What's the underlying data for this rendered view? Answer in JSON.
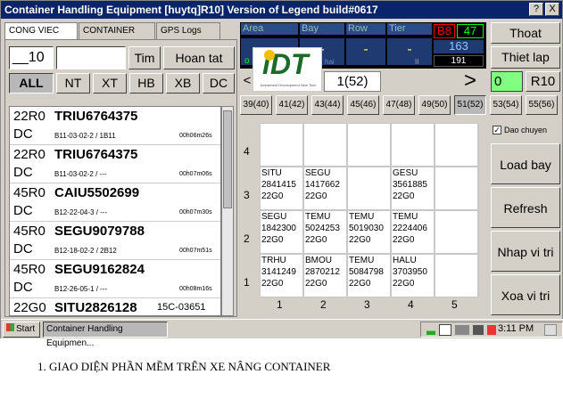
{
  "window": {
    "title": "Container Handling Equipment [huytq]R10] Version of Legend build#0617",
    "help": "?",
    "close": "X"
  },
  "tabs": [
    "CONG VIEC",
    "CONTAINER",
    "GPS Logs"
  ],
  "job_input": {
    "value": "__10",
    "value2": ""
  },
  "buttons": {
    "tim": "Tim",
    "hoan_tat": "Hoan tat"
  },
  "filters": [
    "ALL",
    "NT",
    "XT",
    "HB",
    "XB",
    "DC"
  ],
  "jobs": [
    {
      "size": "22R0",
      "container": "TRIU6764375",
      "type": "DC",
      "loc": "B11-03-02-2 / 1B11",
      "time": "00h06m26s"
    },
    {
      "size": "22R0",
      "container": "TRIU6764375",
      "type": "DC",
      "loc": "B11-03-02-2 / ---",
      "time": "00h07m06s"
    },
    {
      "size": "45R0",
      "container": "CAIU5502699",
      "type": "DC",
      "loc": "B12-22-04-3 / ---",
      "time": "00h07m30s"
    },
    {
      "size": "45R0",
      "container": "SEGU9079788",
      "type": "DC",
      "loc": "B12-18-02-2 / 2B12",
      "time": "00h07m51s"
    },
    {
      "size": "45R0",
      "container": "SEGU9162824",
      "type": "DC",
      "loc": "B12-26-05-1 / ---",
      "time": "00h08m16s"
    },
    {
      "size": "22G0",
      "container": "SITU2826128",
      "type": "",
      "loc": "15C-03651",
      "time": ""
    }
  ],
  "info": {
    "headers": [
      "Area",
      "Bay",
      "Row",
      "Tier"
    ],
    "values": [
      "-",
      "-",
      "-",
      "-"
    ],
    "footer_left": "o",
    "footer_right": "hai",
    "footer_pause": "II"
  },
  "status": {
    "b8": "B8",
    "v47": "47",
    "v163": "163",
    "v191": "191"
  },
  "nav": {
    "left": "<",
    "bay_label": "1(52)",
    "right": ">",
    "zero": "0",
    "r10": "R10"
  },
  "logo": {
    "text": "iDT",
    "sub": "Investment Development New Tech"
  },
  "bays": [
    "39(40)",
    "41(42)",
    "43(44)",
    "45(46)",
    "47(48)",
    "49(50)",
    "51(52)",
    "53(54)",
    "55(56)"
  ],
  "side_buttons": {
    "thoat": "Thoat",
    "thiet_lap": "Thiet lap",
    "dao_chuyen": "Dao chuyen",
    "load_bay": "Load bay",
    "refresh": "Refresh",
    "nhap": "Nhap vi tri",
    "xoa": "Xoa vi tri"
  },
  "tiers": [
    "4",
    "3",
    "2",
    "1"
  ],
  "cols": [
    "1",
    "2",
    "3",
    "4",
    "5"
  ],
  "cells": [
    {
      "col": 0,
      "tier": 1,
      "lines": [
        "SITU",
        "2841415",
        "22G0"
      ]
    },
    {
      "col": 1,
      "tier": 1,
      "lines": [
        "SEGU",
        "1417662",
        "22G0"
      ]
    },
    {
      "col": 3,
      "tier": 1,
      "lines": [
        "GESU",
        "3561885",
        "22G0"
      ]
    },
    {
      "col": 0,
      "tier": 2,
      "lines": [
        "SEGU",
        "1842300",
        "22G0"
      ]
    },
    {
      "col": 1,
      "tier": 2,
      "lines": [
        "TEMU",
        "5024253",
        "22G0"
      ]
    },
    {
      "col": 2,
      "tier": 2,
      "lines": [
        "TEMU",
        "5019030",
        "22G0"
      ]
    },
    {
      "col": 3,
      "tier": 2,
      "lines": [
        "TEMU",
        "2224406",
        "22G0"
      ]
    },
    {
      "col": 0,
      "tier": 3,
      "lines": [
        "TRHU",
        "3141249",
        "22G0"
      ]
    },
    {
      "col": 1,
      "tier": 3,
      "lines": [
        "BMOU",
        "2870212",
        "22G0"
      ]
    },
    {
      "col": 2,
      "tier": 3,
      "lines": [
        "TEMU",
        "5084798",
        "22G0"
      ]
    },
    {
      "col": 3,
      "tier": 3,
      "lines": [
        "HALU",
        "3703950",
        "22G0"
      ]
    }
  ],
  "taskbar": {
    "start": "Start",
    "task": "Container Handling Equipmen...",
    "time": "3:11 PM"
  },
  "caption": "1.   GIAO DIỆN PHẦN MỀM TRÊN XE NÂNG CONTAINER"
}
